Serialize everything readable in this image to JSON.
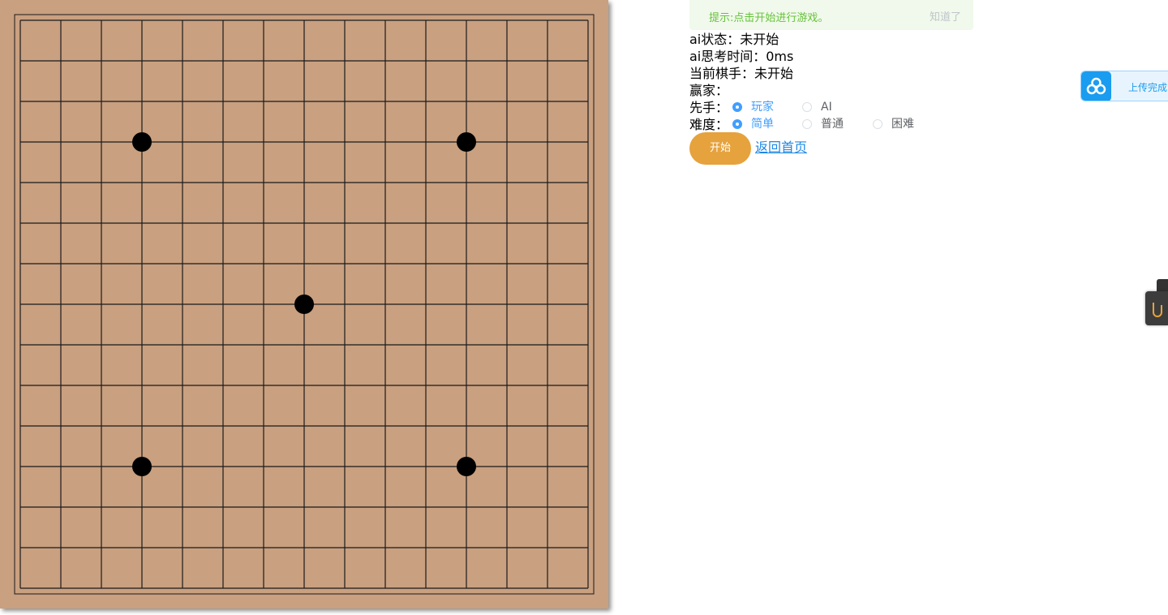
{
  "board": {
    "background": "#c9a080",
    "line_color": "#1a1a1a",
    "grid_lines": 15,
    "stones": [
      {
        "col": 3,
        "row": 3,
        "color": "black"
      },
      {
        "col": 11,
        "row": 3,
        "color": "black"
      },
      {
        "col": 7,
        "row": 7,
        "color": "black"
      },
      {
        "col": 3,
        "row": 11,
        "color": "black"
      },
      {
        "col": 11,
        "row": 11,
        "color": "black"
      }
    ]
  },
  "tip": {
    "text": "提示:点击开始进行游戏。",
    "close_label": "知道了"
  },
  "status": {
    "ai_state": "ai状态：未开始",
    "ai_think_time": "ai思考时间：0ms",
    "current_player": "当前棋手：未开始",
    "winner": "赢家："
  },
  "first_move": {
    "label": "先手：",
    "options": [
      "玩家",
      "AI"
    ],
    "selected": "玩家"
  },
  "difficulty": {
    "label": "难度：",
    "options": [
      "简单",
      "普通",
      "困难"
    ],
    "selected": "简单"
  },
  "actions": {
    "start_label": "开始",
    "home_label": "返回首页"
  },
  "upload_widget": {
    "text": "上传完成",
    "icon": "cloud-share-icon"
  },
  "colors": {
    "accent": "#409eff",
    "start_button": "#e6a23c",
    "tip_background": "#f0f9eb",
    "tip_text": "#67c23a",
    "link": "#1e88e5"
  }
}
